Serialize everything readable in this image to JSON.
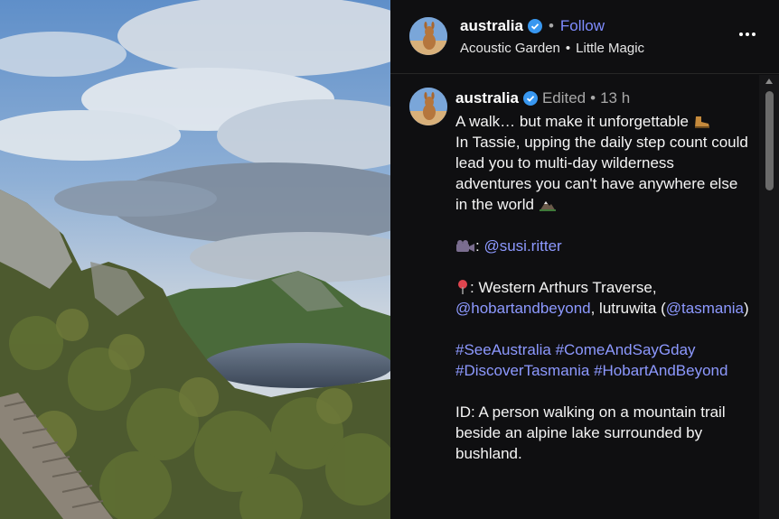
{
  "header": {
    "username": "australia",
    "follow_label": "Follow",
    "audio_artist": "Acoustic Garden",
    "audio_track": "Little Magic",
    "separator": "•"
  },
  "caption": {
    "username": "australia",
    "edited": "Edited",
    "separator": "•",
    "time": "13 h",
    "line1": "A walk… but make it unforgettable",
    "line2": "In Tassie, upping the daily step count could lead you to multi-day wilderness adventures you can't have anywhere else in the world",
    "credit_sep": ":",
    "credit_handle": "@susi.ritter",
    "location_prefix": ": Western Arthurs Traverse,",
    "location_handle1": "@hobartandbeyond",
    "location_mid": ", lutruwita",
    "location_paren_open": "(",
    "location_handle2": "@tasmania",
    "location_paren_close": ")",
    "hashtag1": "#SeeAustralia",
    "hashtag2": "#ComeAndSayGday",
    "hashtag3": "#DiscoverTasmania",
    "hashtag4": "#HobartAndBeyond",
    "id_text": "ID: A person walking on a mountain trail beside an alpine lake surrounded by bushland."
  },
  "colors": {
    "panel_bg": "#0f0f11",
    "link": "#8d99ff",
    "follow": "#7f8cff",
    "verified": "#3897f0"
  },
  "icons": {
    "verified": "verified-badge-icon",
    "more": "more-options-icon",
    "boot": "hiking-boot-emoji",
    "mountain": "mountain-emoji",
    "camera": "video-camera-emoji",
    "pin": "location-pin-emoji"
  }
}
